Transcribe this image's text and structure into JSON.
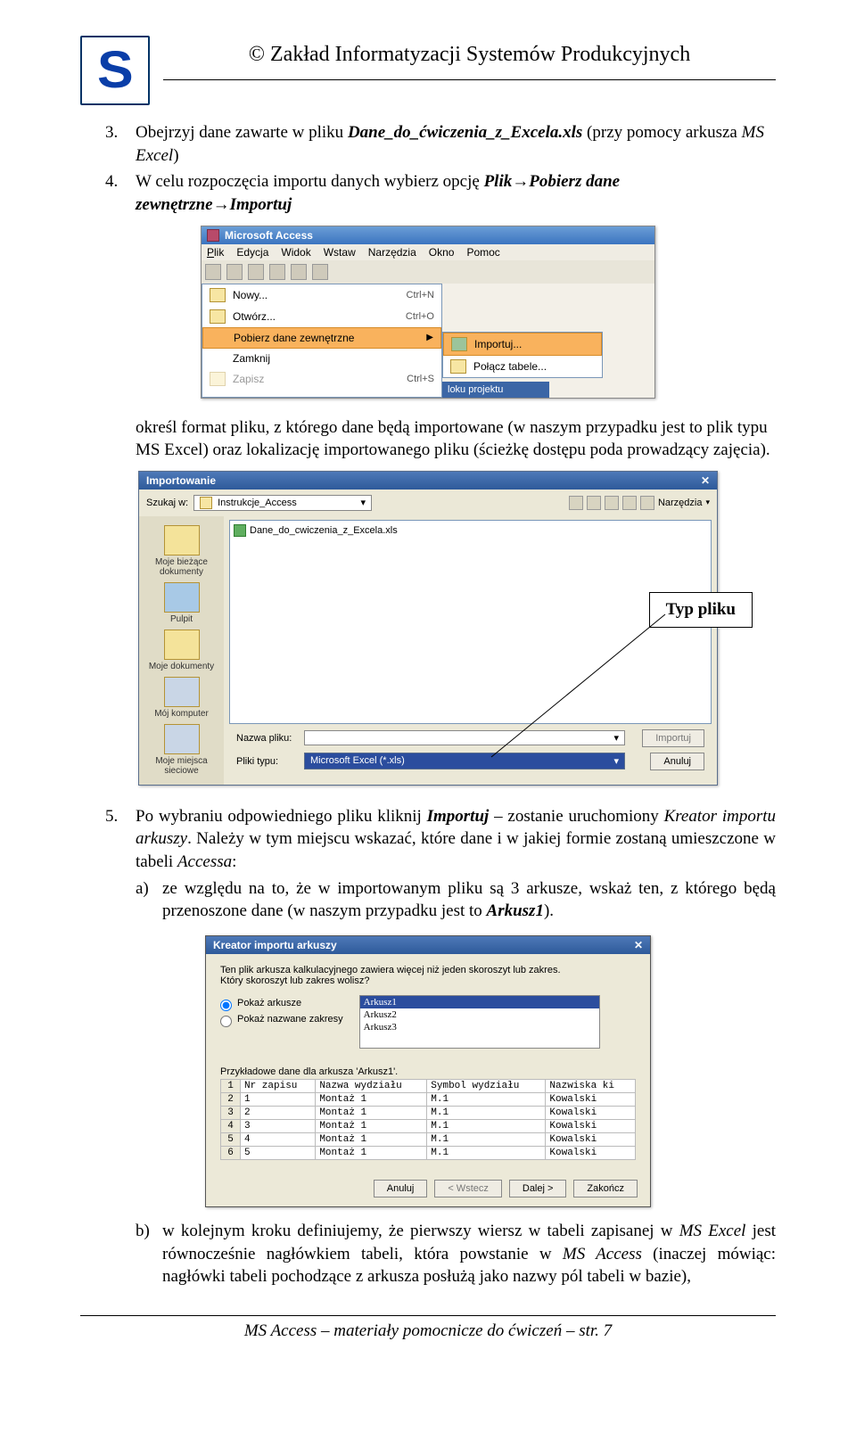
{
  "header": {
    "copyright": "© Zakład Informatyzacji Systemów Produkcyjnych"
  },
  "p3": {
    "num": "3.",
    "text_a": "Obejrzyj dane zawarte w pliku ",
    "file": "Dane_do_ćwiczenia_z_Excela.xls",
    "text_b": " (przy pomocy arkusza ",
    "app": "MS Excel",
    "text_c": ")"
  },
  "p4": {
    "num": "4.",
    "text_a": "W celu rozpoczęcia importu danych wybierz opcję ",
    "path": "Plik→Pobierz dane zewnętrzne→Importuj"
  },
  "access_menu": {
    "title": "Microsoft Access",
    "menus": {
      "plik": "Plik",
      "edycja": "Edycja",
      "widok": "Widok",
      "wstaw": "Wstaw",
      "narzedzia": "Narzędzia",
      "okno": "Okno",
      "pomoc": "Pomoc"
    },
    "items": {
      "nowy": "Nowy...",
      "otworz": "Otwórz...",
      "pobierz": "Pobierz dane zewnętrzne",
      "zamknij": "Zamknij",
      "zapisz": "Zapisz"
    },
    "shortcuts": {
      "nowy": "Ctrl+N",
      "otworz": "Ctrl+O",
      "zapisz": "Ctrl+S"
    },
    "subitems": {
      "importuj": "Importuj...",
      "polacz": "Połącz tabele..."
    },
    "proj": "loku projektu"
  },
  "p4b": {
    "text": "określ format pliku, z którego dane będą importowane (w naszym przypadku jest to plik typu MS Excel) oraz lokalizację importowanego pliku (ścieżkę dostępu poda prowadzący zajęcia)."
  },
  "file_dialog": {
    "title": "Importowanie",
    "lookin_lbl": "Szukaj w:",
    "lookin_val": "Instrukcje_Access",
    "tools": "Narzędzia",
    "file_item": "Dane_do_cwiczenia_z_Excela.xls",
    "side": {
      "recent": "Moje bieżące dokumenty",
      "desktop": "Pulpit",
      "mydocs": "Moje dokumenty",
      "mycomp": "Mój komputer",
      "mynet": "Moje miejsca sieciowe"
    },
    "name_lbl": "Nazwa pliku:",
    "type_lbl": "Pliki typu:",
    "type_val": "Microsoft Excel (*.xls)",
    "btn_import": "Importuj",
    "btn_cancel": "Anuluj",
    "callout": "Typ pliku"
  },
  "p5": {
    "num": "5.",
    "text_a": "Po wybraniu odpowiedniego pliku kliknij ",
    "imp": "Importuj",
    "text_b": " – zostanie uruchomiony ",
    "kre": "Kreator importu arkuszy",
    "text_c": ". Należy w tym miejscu wskazać, które dane i w jakiej formie zostaną umieszczone w tabeli ",
    "acc": "Accessa",
    "text_d": ":",
    "a_lbl": "a)",
    "a_text_pre": "ze względu na to, że w importowanym pliku są 3 arkusze, wskaż ten, z którego będą przenoszone dane (w naszym przypadku jest to ",
    "ark": "Arkusz1",
    "a_text_post": ")."
  },
  "wizard": {
    "title": "Kreator importu arkuszy",
    "desc1": "Ten plik arkusza kalkulacyjnego zawiera więcej niż jeden skoroszyt lub zakres.",
    "desc2": "Który skoroszyt lub zakres wolisz?",
    "opt1": "Pokaż arkusze",
    "opt2": "Pokaż nazwane zakresy",
    "sheets": [
      "Arkusz1",
      "Arkusz2",
      "Arkusz3"
    ],
    "sample_lbl": "Przykładowe dane dla arkusza 'Arkusz1'.",
    "headers": [
      "Nr zapisu",
      "Nazwa wydziału",
      "Symbol wydziału",
      "Nazwiska ki"
    ],
    "rows": [
      [
        "1",
        "1",
        "Montaż 1",
        "M.1",
        "Kowalski"
      ],
      [
        "2",
        "1",
        "Montaż 1",
        "M.1",
        "Kowalski"
      ],
      [
        "3",
        "2",
        "Montaż 1",
        "M.1",
        "Kowalski"
      ],
      [
        "4",
        "3",
        "Montaż 1",
        "M.1",
        "Kowalski"
      ],
      [
        "5",
        "4",
        "Montaż 1",
        "M.1",
        "Kowalski"
      ],
      [
        "6",
        "5",
        "Montaż 1",
        "M.1",
        "Kowalski"
      ]
    ],
    "btn_cancel": "Anuluj",
    "btn_back": "< Wstecz",
    "btn_next": "Dalej >",
    "btn_finish": "Zakończ"
  },
  "p5b": {
    "lbl": "b)",
    "text_a": "w kolejnym kroku definiujemy, że pierwszy wiersz w tabeli zapisanej w ",
    "excel": "MS Excel",
    "text_b": " jest równocześnie nagłówkiem tabeli, która powstanie w ",
    "access": "MS Access",
    "text_c": " (inaczej mówiąc: nagłówki tabeli pochodzące z arkusza posłużą jako nazwy pól tabeli w bazie),"
  },
  "footer": {
    "text_a": "MS Access",
    "text_b": " – materiały pomocnicze do ćwiczeń – str. 7"
  }
}
